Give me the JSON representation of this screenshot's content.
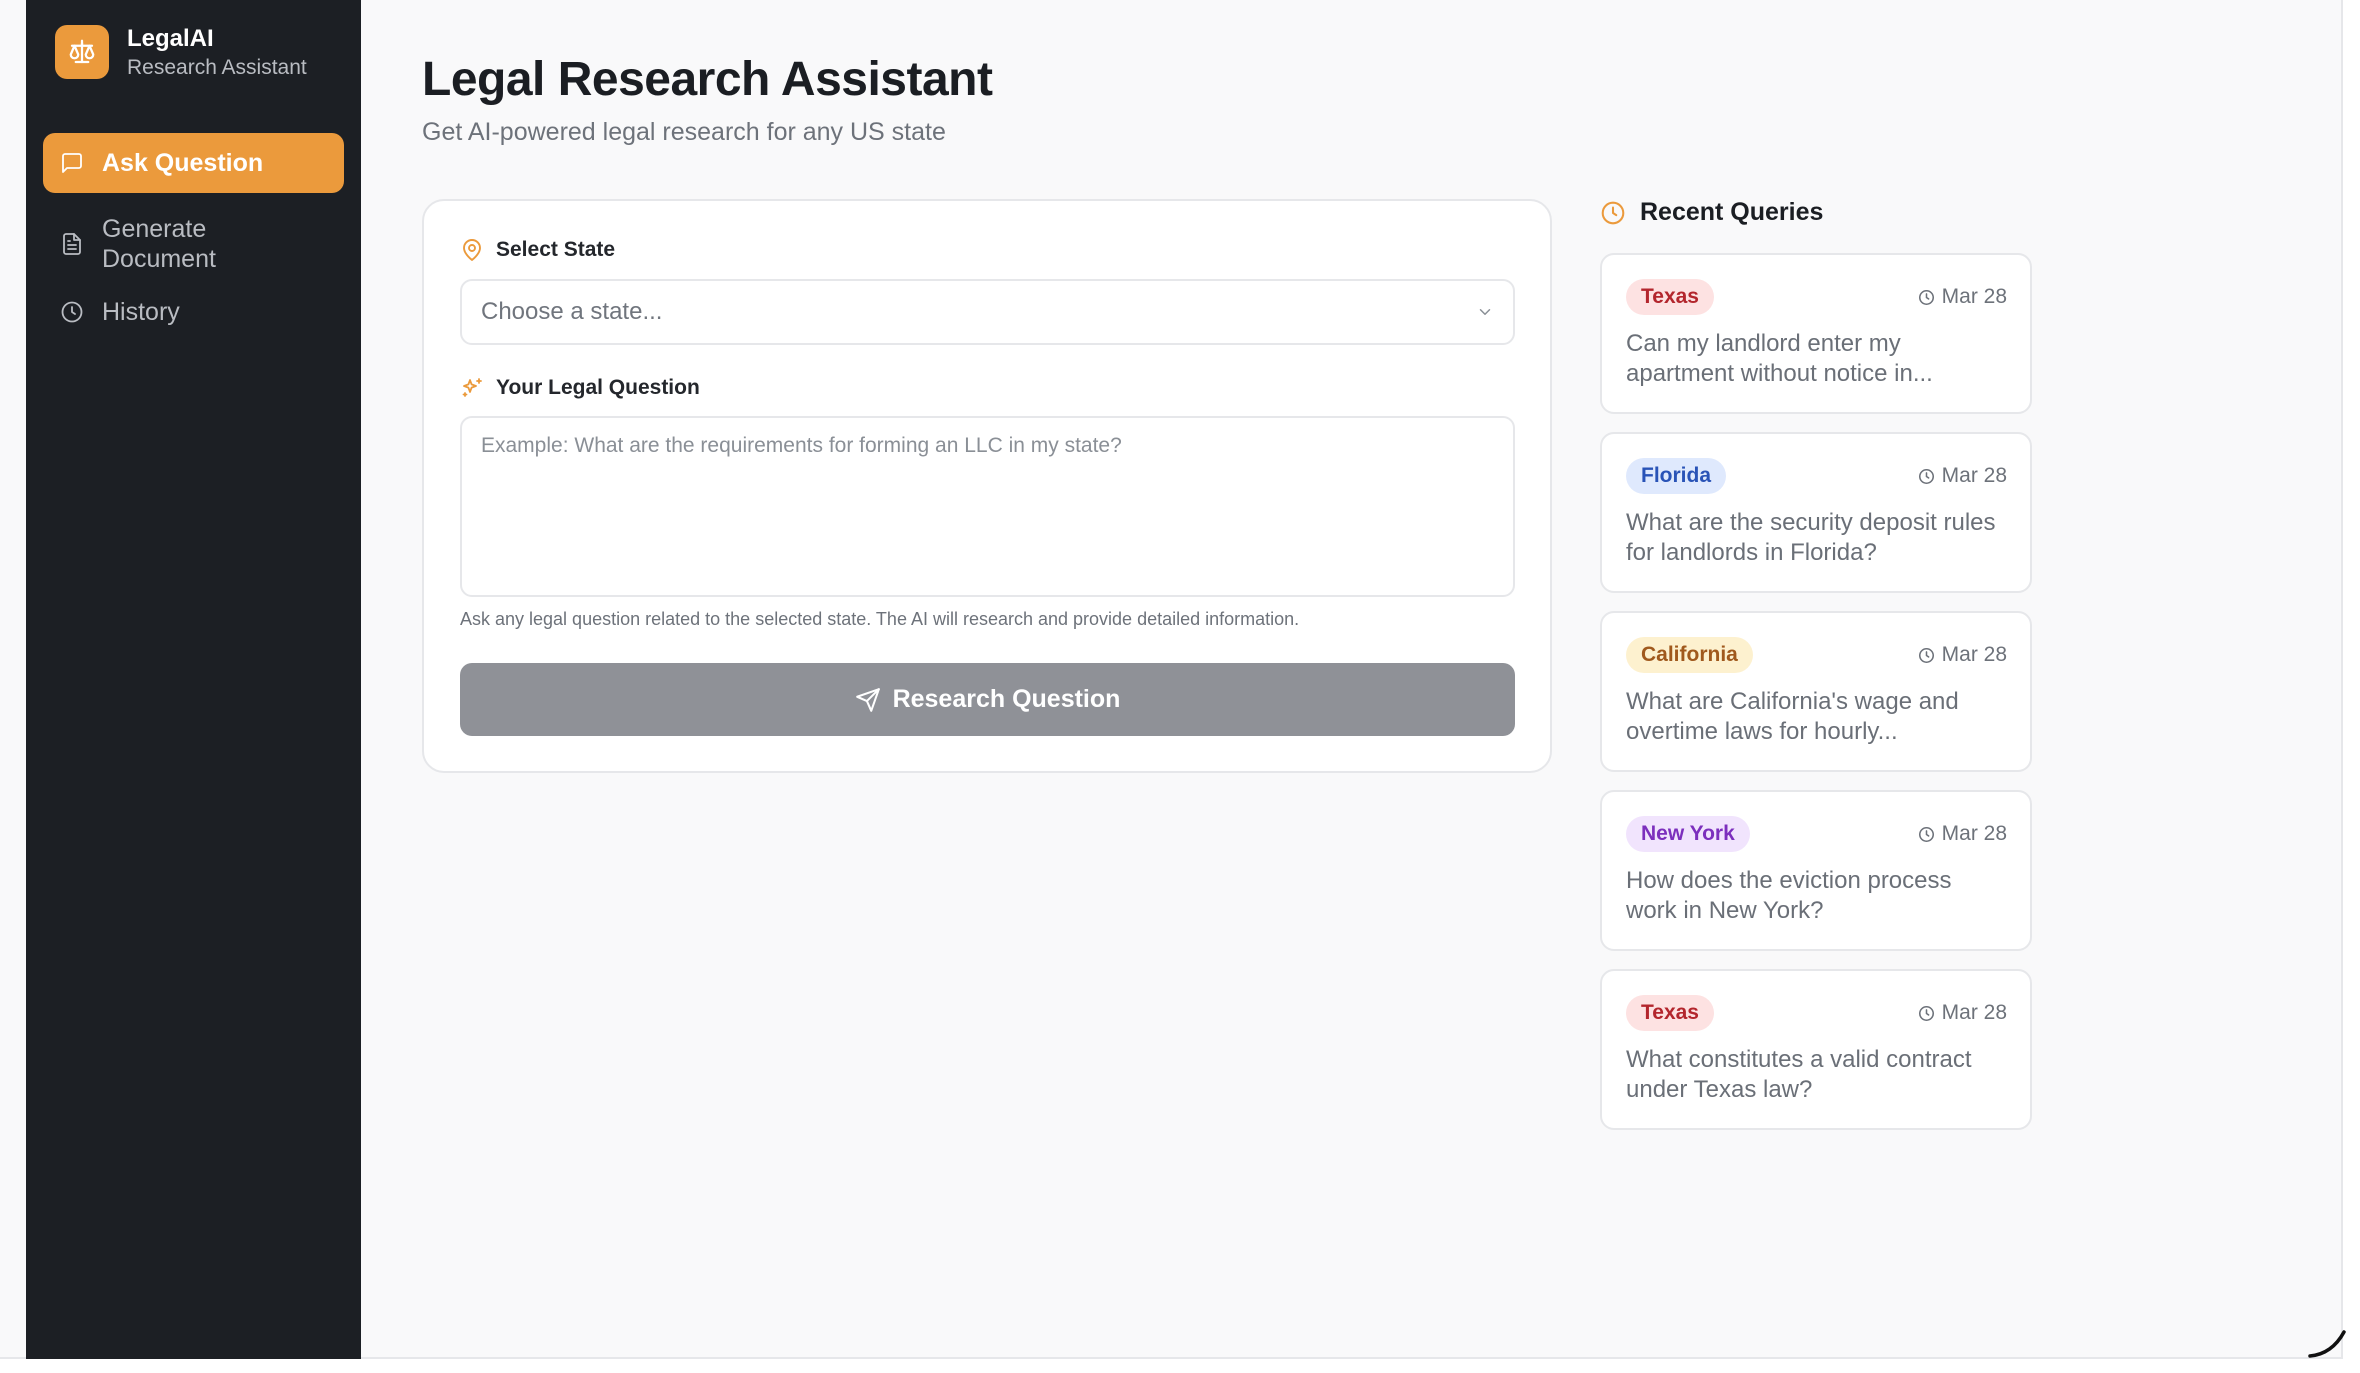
{
  "brand": {
    "name": "LegalAI",
    "subtitle": "Research Assistant",
    "icon": "scale-icon"
  },
  "nav": {
    "items": [
      {
        "label": "Ask Question",
        "icon": "message-square-icon",
        "active": true
      },
      {
        "label": "Generate Document",
        "icon": "file-text-icon",
        "active": false
      },
      {
        "label": "History",
        "icon": "clock-icon",
        "active": false
      }
    ]
  },
  "header": {
    "title": "Legal Research Assistant",
    "subtitle": "Get AI-powered legal research for any US state"
  },
  "form": {
    "state_label": "Select State",
    "state_placeholder": "Choose a state...",
    "question_label": "Your Legal Question",
    "question_placeholder": "Example: What are the requirements for forming an LLC in my state?",
    "hint": "Ask any legal question related to the selected state. The AI will research and provide detailed information.",
    "submit_label": "Research Question"
  },
  "recent": {
    "title": "Recent Queries",
    "items": [
      {
        "state": "Texas",
        "date": "Mar 28",
        "question": "Can my landlord enter my apartment without notice in..."
      },
      {
        "state": "Florida",
        "date": "Mar 28",
        "question": "What are the security deposit rules for landlords in Florida?"
      },
      {
        "state": "California",
        "date": "Mar 28",
        "question": "What are California's wage and overtime laws for hourly..."
      },
      {
        "state": "New York",
        "date": "Mar 28",
        "question": "How does the eviction process work in New York?"
      },
      {
        "state": "Texas",
        "date": "Mar 28",
        "question": "What constitutes a valid contract under Texas law?"
      }
    ]
  },
  "colors": {
    "accent": "#eb9a3c",
    "sidebar_bg": "#1c1f24",
    "button_disabled": "#8f9197",
    "badge_texas": "#b3262d",
    "badge_florida": "#2953b7",
    "badge_california": "#a0591d",
    "badge_new_york": "#7c2fbd"
  }
}
